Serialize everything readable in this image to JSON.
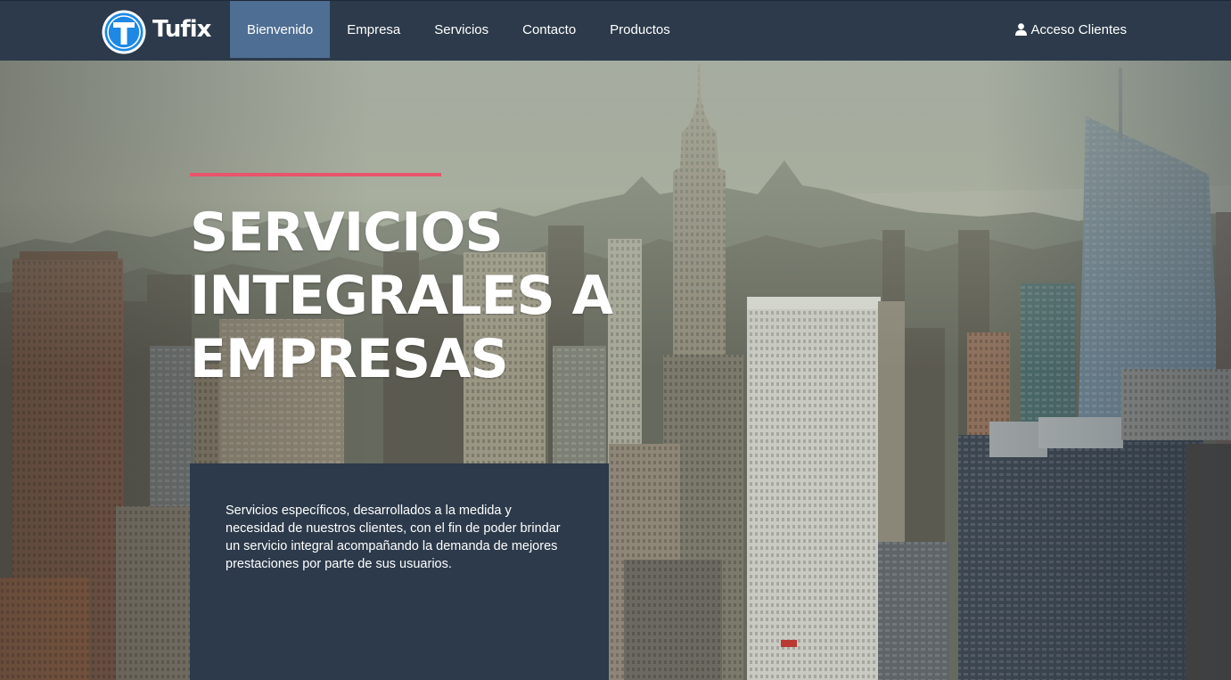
{
  "brand": {
    "name": "Tufix",
    "logo_icon": "circle-t-logo-icon",
    "logo_color": "#1e88e5"
  },
  "nav": {
    "items": [
      {
        "label": "Bienvenido",
        "active": true
      },
      {
        "label": "Empresa",
        "active": false
      },
      {
        "label": "Servicios",
        "active": false
      },
      {
        "label": "Contacto",
        "active": false
      },
      {
        "label": "Productos",
        "active": false
      }
    ],
    "active_color": "#4e6e93",
    "client_access": {
      "label": "Acceso Clientes",
      "icon": "user-icon"
    }
  },
  "hero": {
    "title": "SERVICIOS INTEGRALES A EMPRESAS",
    "accent_color": "#e9546b",
    "description": "Servicios específicos, desarrollados a la medida y necesidad de nuestros clientes, con el fin de poder brindar un servicio integral acompañando la demanda de mejores prestaciones por parte de sus usuarios.",
    "panel_color": "#2c3a4b",
    "background": "city-skyline-photo"
  }
}
